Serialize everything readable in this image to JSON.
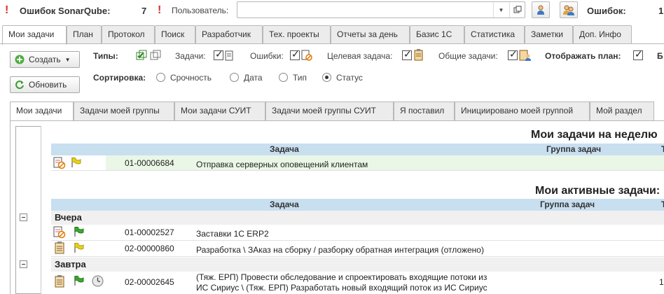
{
  "topbar": {
    "sonar_label": "Ошибок SonarQube:",
    "sonar_count": "7",
    "user_label": "Пользователь:",
    "user_value": "",
    "errors_label": "Ошибок:",
    "errors_count": "1"
  },
  "main_tabs": [
    "Мои задачи",
    "План",
    "Протокол",
    "Поиск",
    "Разработчик",
    "Тех. проекты",
    "Отчеты за день",
    "Базис 1С",
    "Статистика",
    "Заметки",
    "Доп. Инфо"
  ],
  "toolbar": {
    "create_label": "Создать",
    "refresh_label": "Обновить",
    "types_label": "Типы:",
    "tasks_label": "Задачи:",
    "errors_label": "Ошибки:",
    "target_label": "Целевая задача:",
    "common_label": "Общие задачи:",
    "show_plan_label": "Отображать план:",
    "trailing_label": "Б",
    "sort_label": "Сортировка:",
    "sort_options": [
      "Срочность",
      "Дата",
      "Тип",
      "Статус"
    ],
    "sort_selected": "Статус"
  },
  "sub_tabs": [
    "Мои задачи",
    "Задачи моей группы",
    "Мои задачи СУИТ",
    "Задачи моей группы СУИТ",
    "Я поставил",
    "Инициировано моей группой",
    "Мой раздел"
  ],
  "week_section": {
    "title": "Мои задачи на неделю",
    "col_task": "Задача",
    "col_group": "Группа задач",
    "col_t": "Т",
    "rows": [
      {
        "num": "01-00006684",
        "text": "Отправка серверных оповещений клиентам",
        "flag": "yellow"
      }
    ]
  },
  "active_section": {
    "title": "Мои активные задачи:",
    "col_task": "Задача",
    "col_group": "Группа задач",
    "col_t": "Т",
    "groups": [
      {
        "name": "Вчера",
        "rows": [
          {
            "num": "01-00002527",
            "text": "Заставки 1С ERP2",
            "flag": "green"
          },
          {
            "num": "02-00000860",
            "text": "Разработка \\ ЗАказ на сборку / разборку  обратная интеграция (отложено)",
            "flag": "yellow"
          }
        ]
      },
      {
        "name": "Завтра",
        "rows": [
          {
            "num": "02-00002645",
            "text_line1": "(Тяж. ЕРП) Провести обследование и спроектировать входящие потоки из",
            "text_line2": "ИС Сириус \\ (Тяж. ЕРП) Разработать новый входящий поток из ИС Сириус",
            "flag": "green",
            "extra": "1"
          }
        ]
      }
    ]
  },
  "colors": {
    "accent_header": "#c8dff0",
    "highlight_row": "#eaf7e6",
    "flag_yellow": "#e8d21b",
    "flag_green": "#3aa82e",
    "error_red": "#d32f2f"
  }
}
